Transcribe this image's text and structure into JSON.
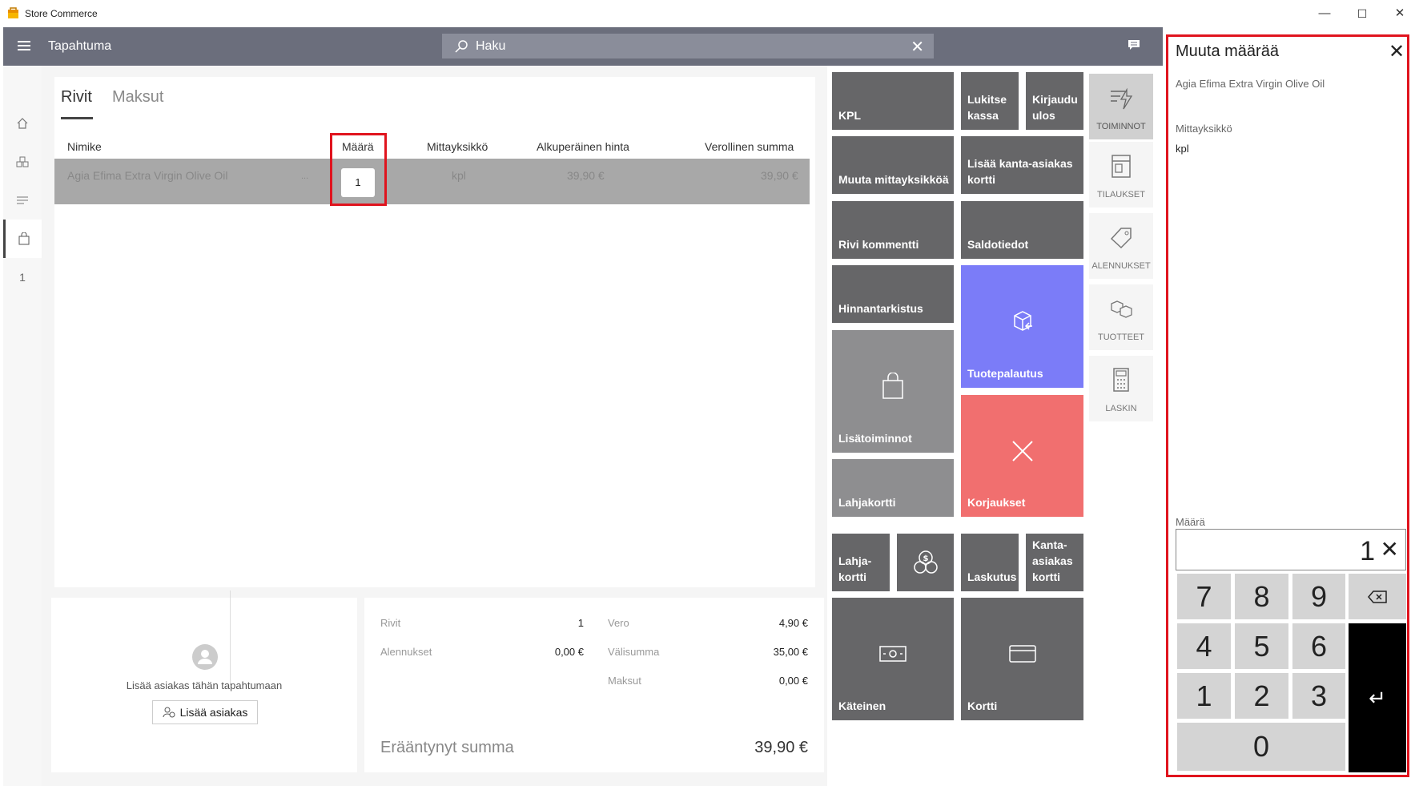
{
  "window": {
    "title": "Store Commerce",
    "minimize": "—",
    "maximize": "☐",
    "close": "✕"
  },
  "header": {
    "title": "Tapahtuma",
    "search_placeholder": "Haku",
    "search_clear": "✕"
  },
  "rail": {
    "count": "1"
  },
  "tabs": [
    {
      "label": "Rivit"
    },
    {
      "label": "Maksut"
    }
  ],
  "table": {
    "columns": [
      "Nimike",
      "Määrä",
      "Mittayksikkö",
      "Alkuperäinen hinta",
      "Verollinen summa"
    ],
    "rows": [
      {
        "name": "Agia Efima Extra Virgin Olive Oil",
        "more": "...",
        "qty": "1",
        "uom": "kpl",
        "orig_price": "39,90 €",
        "total": "39,90 €"
      }
    ]
  },
  "customer": {
    "text": "Lisää asiakas tähän tapahtumaan",
    "button": "Lisää asiakas"
  },
  "totals": {
    "rows_label": "Rivit",
    "rows_value": "1",
    "discounts_label": "Alennukset",
    "discounts_value": "0,00 €",
    "tax_label": "Vero",
    "tax_value": "4,90 €",
    "subtotal_label": "Välisumma",
    "subtotal_value": "35,00 €",
    "payments_label": "Maksut",
    "payments_value": "0,00 €",
    "due_label": "Erääntynyt summa",
    "due_value": "39,90 €"
  },
  "tiles": {
    "kpl": "KPL",
    "lock": "Lukitse kassa",
    "logout": "Kirjaudu ulos",
    "change_uom": "Muuta mittayksikköä",
    "add_loyalty": "Lisää kanta-asiakas kortti",
    "line_comment": "Rivi kommentti",
    "inventory": "Saldotiedot",
    "price_check": "Hinnantarkistus",
    "return": "Tuotepalautus",
    "more": "Lisätoiminnot",
    "voids": "Korjaukset",
    "giftcard": "Lahjakortti",
    "giftcard2": "Lahja-kortti",
    "invoice": "Laskutus",
    "loyalty_card": "Kanta-asiakas kortti",
    "cash": "Käteinen",
    "card": "Kortti"
  },
  "functions": [
    {
      "label": "TOIMINNOT",
      "icon": "actions-icon"
    },
    {
      "label": "TILAUKSET",
      "icon": "orders-icon"
    },
    {
      "label": "ALENNUKSET",
      "icon": "discounts-icon"
    },
    {
      "label": "TUOTTEET",
      "icon": "products-icon"
    },
    {
      "label": "LASKIN",
      "icon": "calculator-icon"
    }
  ],
  "panel": {
    "title": "Muuta määrää",
    "close": "✕",
    "product": "Agia Efima Extra Virgin Olive Oil",
    "uom_label": "Mittayksikkö",
    "uom_value": "kpl",
    "qty_label": "Määrä",
    "qty_value": "1",
    "qty_clear": "✕",
    "keys": [
      "7",
      "8",
      "9",
      "4",
      "5",
      "6",
      "1",
      "2",
      "3",
      "0"
    ],
    "enter": "↵"
  },
  "colors": {
    "header": "#6b6e7c",
    "tile": "#666668",
    "return": "#7b7cf8",
    "voids": "#f16f6f",
    "highlight": "#e0141e"
  }
}
